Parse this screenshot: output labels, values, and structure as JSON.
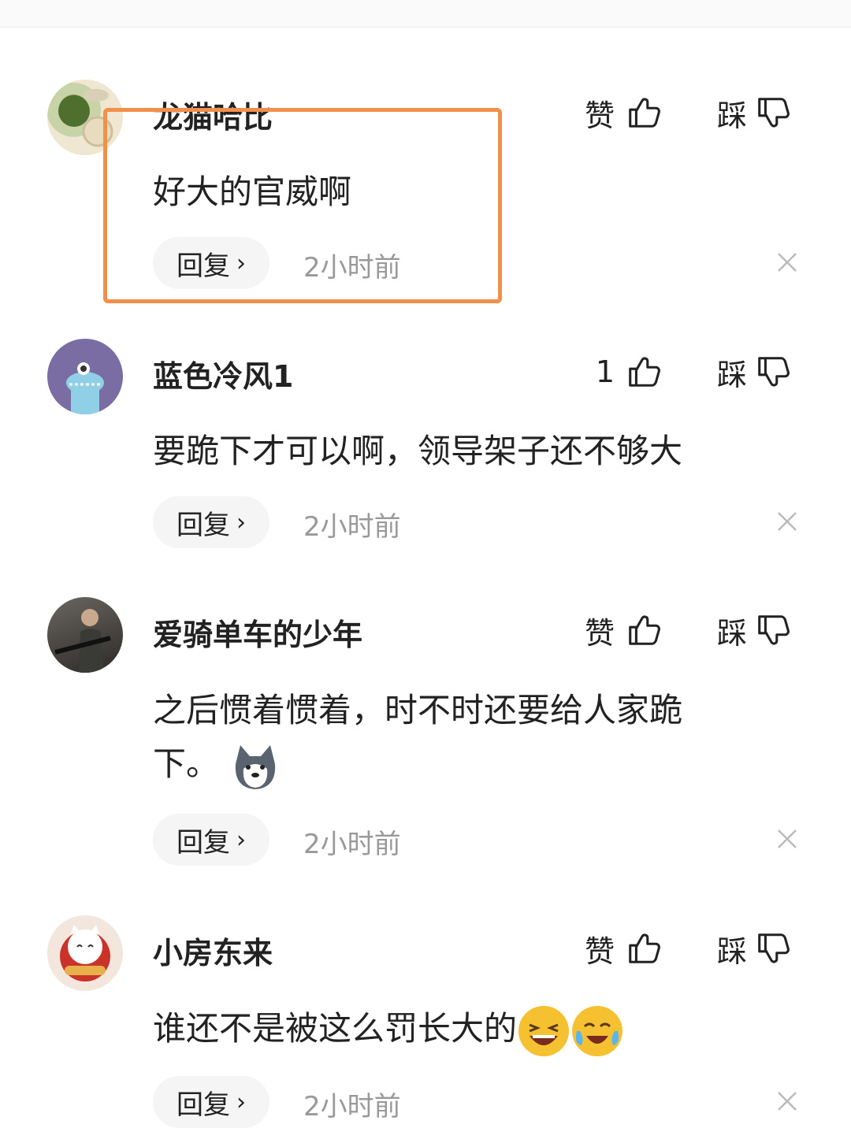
{
  "comments": [
    {
      "username": "龙猫哈比",
      "like_label": "赞",
      "dislike_label": "踩",
      "text": "好大的官威啊",
      "reply_label": "回复",
      "time": "2小时前"
    },
    {
      "username": "蓝色冷风1",
      "like_label": "1",
      "dislike_label": "踩",
      "text": "要跪下才可以啊，领导架子还不够大",
      "reply_label": "回复",
      "time": "2小时前"
    },
    {
      "username": "爱骑单车的少年",
      "like_label": "赞",
      "dislike_label": "踩",
      "text_line1": "之后惯着惯着，时不时还要给人家跪",
      "text_line2": "下。",
      "reply_label": "回复",
      "time": "2小时前"
    },
    {
      "username": "小房东来",
      "like_label": "赞",
      "dislike_label": "踩",
      "text": "谁还不是被这么罚长大的",
      "reply_label": "回复",
      "time": "2小时前"
    }
  ],
  "icons": {
    "like": "thumbs-up-icon",
    "dislike": "thumbs-down-icon",
    "close": "close-icon",
    "chevron": "chevron-right-icon"
  },
  "colors": {
    "highlight": "#f0904a",
    "muted_text": "#999999",
    "reply_bg": "#f5f5f5"
  }
}
